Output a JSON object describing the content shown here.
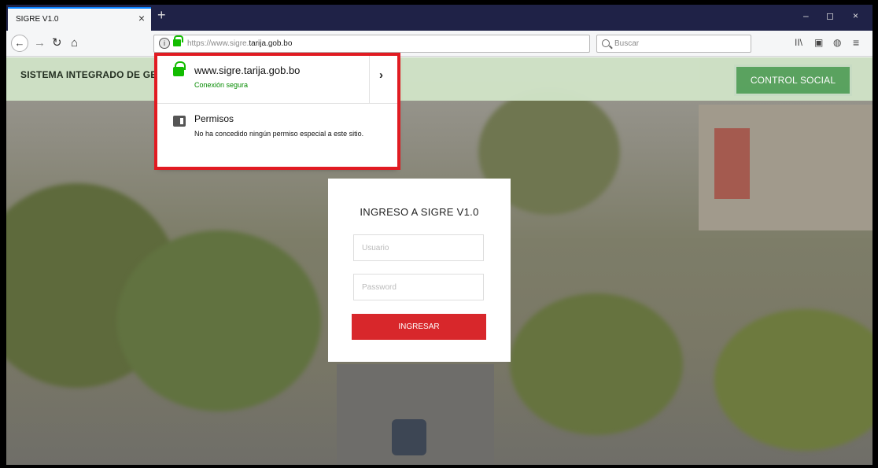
{
  "browser": {
    "tab": {
      "title": "SIGRE V1.0",
      "close": "×"
    },
    "new_tab": "+",
    "window": {
      "minimize": "–",
      "maximize": "◻",
      "close": "×"
    },
    "nav": {
      "back": "←",
      "forward": "→",
      "reload": "↻",
      "home": "⌂"
    },
    "url": {
      "prefix": "https://www.sigre.",
      "domain": "tarija.gob.bo",
      "info_glyph": "i"
    },
    "page_actions": {
      "menu": "···",
      "bookmark": "☆"
    },
    "search": {
      "placeholder": "Buscar"
    },
    "toolbar": {
      "library": "II\\",
      "sidebar": "▣",
      "shield": "◍",
      "menu": "≡"
    }
  },
  "page": {
    "header_title": "SISTEMA INTEGRADO DE GES",
    "control_social": "CONTROL SOCIAL",
    "login": {
      "title": "INGRESO A SIGRE V1.0",
      "user_placeholder": "Usuario",
      "password_placeholder": "Password",
      "button": "INGRESAR"
    }
  },
  "site_popup": {
    "host": "www.sigre.tarija.gob.bo",
    "status": "Conexión segura",
    "chevron": "›",
    "permissions_title": "Permisos",
    "permissions_desc": "No ha concedido ningún permiso especial a este sitio."
  },
  "colors": {
    "tabstrip": "#1f2247",
    "header_band": "#cfe2c6",
    "control_social": "#58a35e",
    "login_button": "#d8272b",
    "highlight": "#e11b22",
    "secure_green": "#12bc00"
  }
}
